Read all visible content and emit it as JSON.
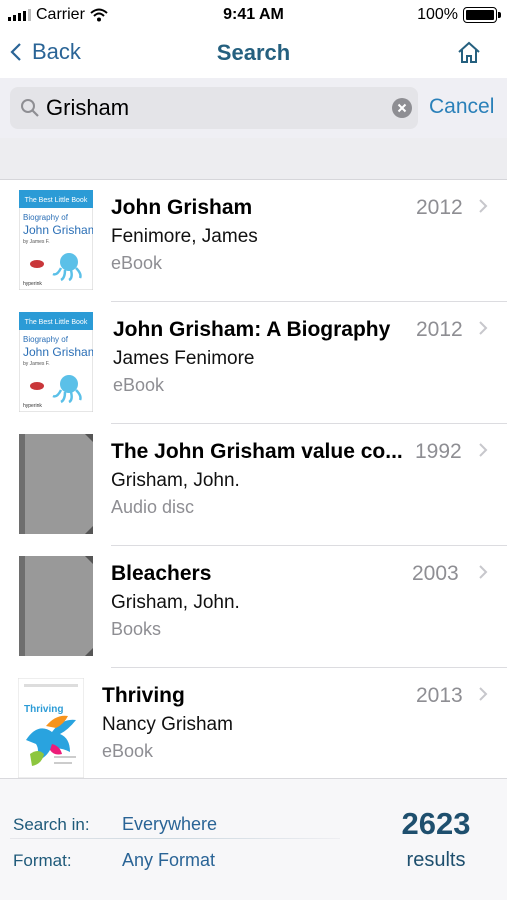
{
  "status_bar": {
    "carrier": "Carrier",
    "time": "9:41 AM",
    "battery": "100%"
  },
  "nav": {
    "back_label": "Back",
    "title": "Search",
    "home_icon": "home-icon"
  },
  "search": {
    "value": "Grisham",
    "cancel_label": "Cancel"
  },
  "results": [
    {
      "title": "John Grisham",
      "author": "Fenimore, James",
      "format": "eBook",
      "year": "2012",
      "cover": "hyperink"
    },
    {
      "title": "John Grisham: A Biography",
      "author": "James Fenimore",
      "format": "eBook",
      "year": "2012",
      "cover": "hyperink"
    },
    {
      "title": "The John Grisham value co...",
      "author": "Grisham, John.",
      "format": "Audio disc",
      "year": "1992",
      "cover": "plain"
    },
    {
      "title": "Bleachers",
      "author": "Grisham, John.",
      "format": "Books",
      "year": "2003",
      "cover": "plain"
    },
    {
      "title": "Thriving",
      "author": "Nancy Grisham",
      "format": "eBook",
      "year": "2013",
      "cover": "thriving"
    }
  ],
  "covers": {
    "hyperink": {
      "banner": "The Best Little Book",
      "line1": "Biography of",
      "line2": "John Grisham",
      "line3": "by James F.",
      "brand": "hyperink"
    },
    "thriving": {
      "title": "Thriving"
    }
  },
  "bottom": {
    "search_in_label": "Search in:",
    "search_in_value": "Everywhere",
    "format_label": "Format:",
    "format_value": "Any Format",
    "count": "2623",
    "count_label": "results"
  },
  "colors": {
    "accent": "#2A80B9",
    "title": "#25607F",
    "muted": "#8E8E93",
    "cover_blue": "#2B9BD6"
  }
}
